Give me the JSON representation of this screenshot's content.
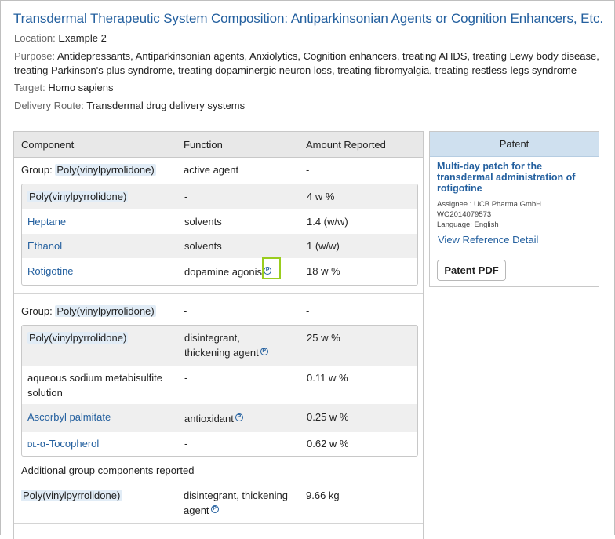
{
  "title": "Transdermal Therapeutic System Composition: Antiparkinsonian Agents or Cognition Enhancers, Etc.",
  "meta": {
    "location_label": "Location:",
    "location": "Example 2",
    "purpose_label": "Purpose:",
    "purpose": "Antidepressants, Antiparkinsonian agents, Anxiolytics, Cognition enhancers, treating AHDS, treating Lewy body disease, treating Parkinson's plus syndrome, treating dopaminergic neuron loss, treating fibromyalgia, treating restless-legs syndrome",
    "target_label": "Target:",
    "target": "Homo sapiens",
    "route_label": "Delivery Route:",
    "route": "Transdermal drug delivery systems"
  },
  "table": {
    "headers": [
      "Component",
      "Function",
      "Amount Reported"
    ],
    "group1": {
      "label": "Group:",
      "name": "Poly(vinylpyrrolidone)",
      "function": "active agent",
      "amount": "-",
      "rows": [
        {
          "component": "Poly(vinylpyrrolidone)",
          "function": "-",
          "amount": "4 w %"
        },
        {
          "component": "Heptane",
          "function": "solvents",
          "amount": "1.4 (w/w)"
        },
        {
          "component": "Ethanol",
          "function": "solvents",
          "amount": "1 (w/w)"
        },
        {
          "component": "Rotigotine",
          "function": "dopamine agonis",
          "amount": "18 w %"
        }
      ]
    },
    "group2": {
      "label": "Group:",
      "name": "Poly(vinylpyrrolidone)",
      "function": "-",
      "amount": "-",
      "rows": [
        {
          "component": "Poly(vinylpyrrolidone)",
          "function_line1": "disintegrant,",
          "function_line2": "thickening agent",
          "amount": "25 w %"
        },
        {
          "component_line1": "aqueous sodium metabisulfite",
          "component_line2": "solution",
          "function": "-",
          "amount": "0.11 w %"
        },
        {
          "component": "Ascorbyl palmitate",
          "function": "antioxidant",
          "amount": "0.25 w %"
        },
        {
          "component_prefix": "DL",
          "component": "-α-Tocopherol",
          "function": "-",
          "amount": "0.62 w %"
        }
      ]
    },
    "additional_label": "Additional group components reported",
    "extra_row": {
      "component": "Poly(vinylpyrrolidone)",
      "function_line1": "disintegrant, thickening",
      "function_line2": "agent",
      "amount": "9.66 kg"
    },
    "note_glyph": "P"
  },
  "patent": {
    "header": "Patent",
    "title": "Multi-day patch for the transdermal administration of rotigotine",
    "assignee": "Assignee : UCB Pharma GmbH",
    "number": "WO2014079573",
    "language": "Language: English",
    "detail_link": "View Reference Detail",
    "pdf_button": "Patent PDF"
  }
}
